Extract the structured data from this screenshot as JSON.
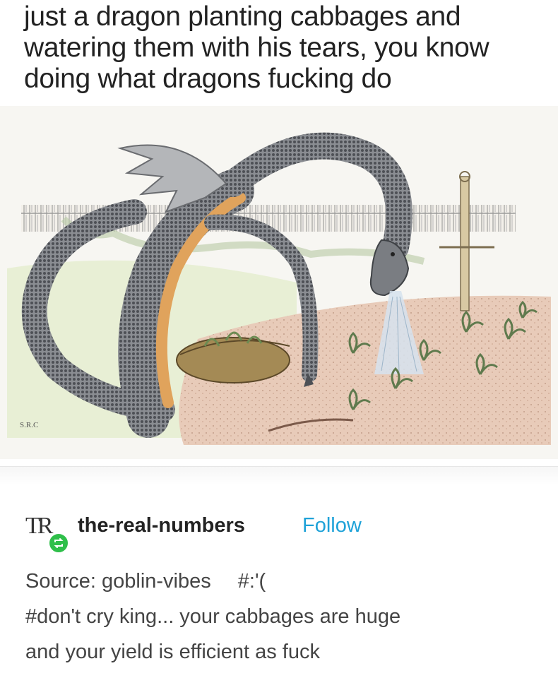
{
  "caption": {
    "lines": [
      "just a dragon planting cabbages  and",
      "watering them with his tears, you know",
      "doing what dragons fucking do"
    ]
  },
  "illustration": {
    "signature": "S.R.C"
  },
  "post": {
    "avatar_text": "TR",
    "username": "the-real-numbers",
    "follow_label": "Follow",
    "source_label": "Source: goblin-vibes",
    "tags": [
      "#:'(",
      "#don't cry king... your cabbages are huge",
      "and your yield is efficient as fuck"
    ]
  },
  "colors": {
    "follow": "#1fa2d8",
    "reblog_badge": "#2fbf4a",
    "dragon_body": "#6e7176",
    "dragon_belly": "#e0a35c",
    "wing": "#a7a9ac"
  }
}
